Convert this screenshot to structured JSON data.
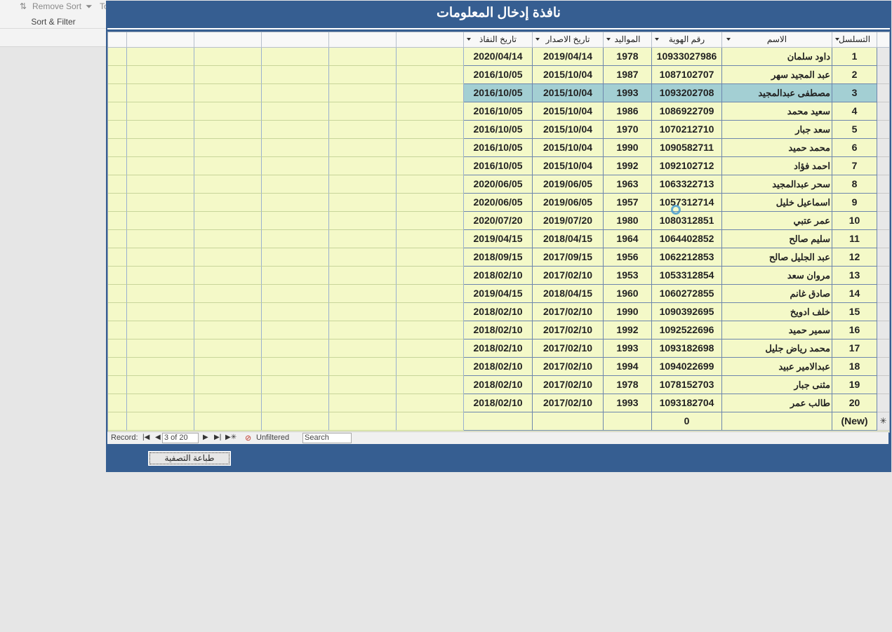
{
  "ribbon": {
    "remove_sort": "Remove Sort",
    "toggle_partial": "To",
    "group_label": "Sort & Filter"
  },
  "form": {
    "title": "نافذة إدخال المعلومات",
    "columns": {
      "seq": "التسلسل",
      "name": "الاسم",
      "id": "رقم الهوية",
      "birth": "المواليد",
      "issue": "تاريخ الاصدار",
      "expiry": "تاريخ النفاذ"
    },
    "rows": [
      {
        "seq": "1",
        "name": "داود سلمان",
        "id": "10933027986",
        "birth": "1978",
        "issue": "2019/04/14",
        "expiry": "2020/04/14"
      },
      {
        "seq": "2",
        "name": "عبد المجيد سهر",
        "id": "1087102707",
        "birth": "1987",
        "issue": "2015/10/04",
        "expiry": "2016/10/05"
      },
      {
        "seq": "3",
        "name": "مصطفى عبدالمجيد",
        "id": "1093202708",
        "birth": "1993",
        "issue": "2015/10/04",
        "expiry": "2016/10/05"
      },
      {
        "seq": "4",
        "name": "سعيد محمد",
        "id": "1086922709",
        "birth": "1986",
        "issue": "2015/10/04",
        "expiry": "2016/10/05"
      },
      {
        "seq": "5",
        "name": "سعد جبار",
        "id": "1070212710",
        "birth": "1970",
        "issue": "2015/10/04",
        "expiry": "2016/10/05"
      },
      {
        "seq": "6",
        "name": "محمد حميد",
        "id": "1090582711",
        "birth": "1990",
        "issue": "2015/10/04",
        "expiry": "2016/10/05"
      },
      {
        "seq": "7",
        "name": "احمد فؤاد",
        "id": "1092102712",
        "birth": "1992",
        "issue": "2015/10/04",
        "expiry": "2016/10/05"
      },
      {
        "seq": "8",
        "name": "سحر  عبدالمجيد",
        "id": "1063322713",
        "birth": "1963",
        "issue": "2019/06/05",
        "expiry": "2020/06/05"
      },
      {
        "seq": "9",
        "name": "اسماعيل خليل",
        "id": "1057312714",
        "birth": "1957",
        "issue": "2019/06/05",
        "expiry": "2020/06/05"
      },
      {
        "seq": "10",
        "name": "عمر عتبي",
        "id": "1080312851",
        "birth": "1980",
        "issue": "2019/07/20",
        "expiry": "2020/07/20"
      },
      {
        "seq": "11",
        "name": "سليم صالح",
        "id": "1064402852",
        "birth": "1964",
        "issue": "2018/04/15",
        "expiry": "2019/04/15"
      },
      {
        "seq": "12",
        "name": "عبد الجليل صالح",
        "id": "1062212853",
        "birth": "1956",
        "issue": "2017/09/15",
        "expiry": "2018/09/15"
      },
      {
        "seq": "13",
        "name": "مروان سعد",
        "id": "1053312854",
        "birth": "1953",
        "issue": "2017/02/10",
        "expiry": "2018/02/10"
      },
      {
        "seq": "14",
        "name": "صادق غانم",
        "id": "1060272855",
        "birth": "1960",
        "issue": "2018/04/15",
        "expiry": "2019/04/15"
      },
      {
        "seq": "15",
        "name": "خلف ادويخ",
        "id": "1090392695",
        "birth": "1990",
        "issue": "2017/02/10",
        "expiry": "2018/02/10"
      },
      {
        "seq": "16",
        "name": "سمير حميد",
        "id": "1092522696",
        "birth": "1992",
        "issue": "2017/02/10",
        "expiry": "2018/02/10"
      },
      {
        "seq": "17",
        "name": "محمد رياض جليل",
        "id": "1093182698",
        "birth": "1993",
        "issue": "2017/02/10",
        "expiry": "2018/02/10"
      },
      {
        "seq": "18",
        "name": "عبدالامير عبيد",
        "id": "1094022699",
        "birth": "1994",
        "issue": "2017/02/10",
        "expiry": "2018/02/10"
      },
      {
        "seq": "19",
        "name": "مثنى جبار",
        "id": "1078152703",
        "birth": "1978",
        "issue": "2017/02/10",
        "expiry": "2018/02/10"
      },
      {
        "seq": "20",
        "name": "طالب عمر",
        "id": "1093182704",
        "birth": "1993",
        "issue": "2017/02/10",
        "expiry": "2018/02/10"
      }
    ],
    "new_row": {
      "seq": "(New)",
      "id": "0"
    },
    "selected_index": 2,
    "nav": {
      "record_label": "Record:",
      "record_value": "3 of 20",
      "filter_label": "Unfiltered",
      "search_placeholder": "Search"
    },
    "print_button": "طباعة التصفية"
  },
  "colors": {
    "form_bg": "#365e91",
    "sheet_bg": "#f4f9c8",
    "selected_row": "#a3cfd3"
  }
}
